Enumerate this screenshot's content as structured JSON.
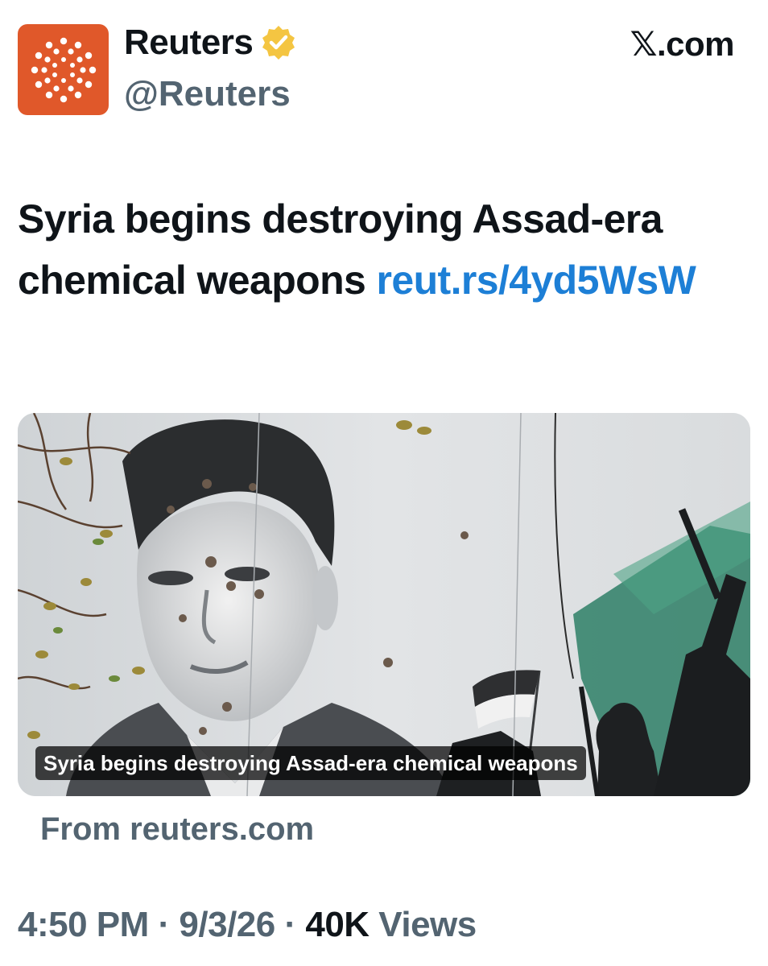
{
  "account": {
    "display_name": "Reuters",
    "handle": "@Reuters",
    "avatar_icon": "reuters-logo-icon",
    "verified_icon": "verified-badge-icon",
    "brand_color": "#e0582a",
    "badge_color": "#f4c542"
  },
  "source_site": {
    "label": "𝕏.com"
  },
  "tweet": {
    "text": "Syria begins destroying Assad-era chemical weapons ",
    "link": "reut.rs/4yd5WsW",
    "link_color": "#1d7fd6"
  },
  "card": {
    "caption": "Syria begins destroying Assad-era chemical weapons",
    "from": "From reuters.com"
  },
  "meta": {
    "time": "4:50 PM",
    "separator": " · ",
    "date": "9/3/26",
    "views_count": "40K",
    "views_label": " Views"
  }
}
